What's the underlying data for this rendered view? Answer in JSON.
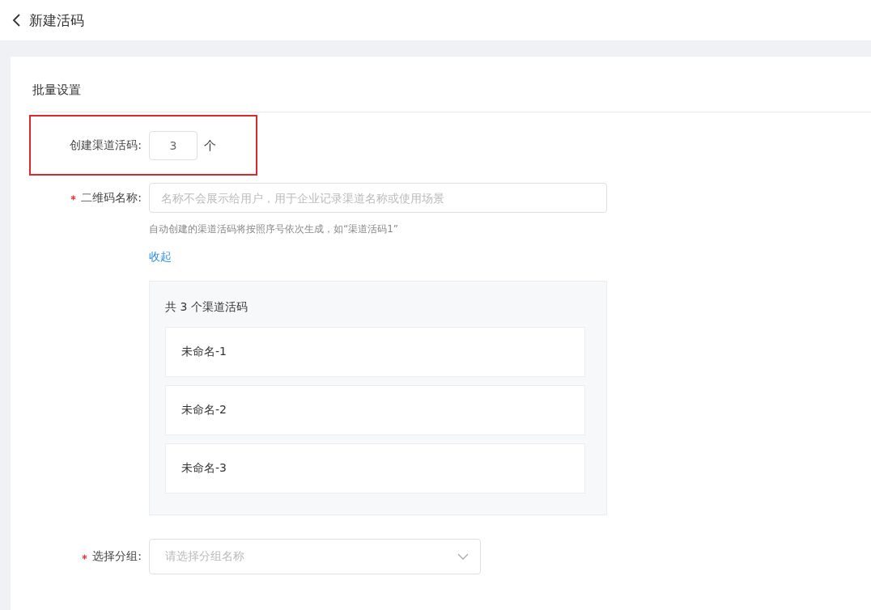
{
  "header": {
    "title": "新建活码"
  },
  "section": {
    "title": "批量设置"
  },
  "count_field": {
    "label": "创建渠道活码:",
    "value": "3",
    "unit": "个",
    "highlighted": true
  },
  "name_field": {
    "label": "二维码名称:",
    "required": true,
    "placeholder": "名称不会展示给用户，用于企业记录渠道名称或使用场景",
    "hint": "自动创建的渠道活码将按照序号依次生成，如“渠道活码1”"
  },
  "collapse_link": "收起",
  "code_list": {
    "title": "共 3 个渠道活码",
    "items": [
      {
        "name": "未命名-1"
      },
      {
        "name": "未命名-2"
      },
      {
        "name": "未命名-3"
      }
    ]
  },
  "group_field": {
    "label": "选择分组:",
    "required": true,
    "placeholder": "请选择分组名称"
  }
}
